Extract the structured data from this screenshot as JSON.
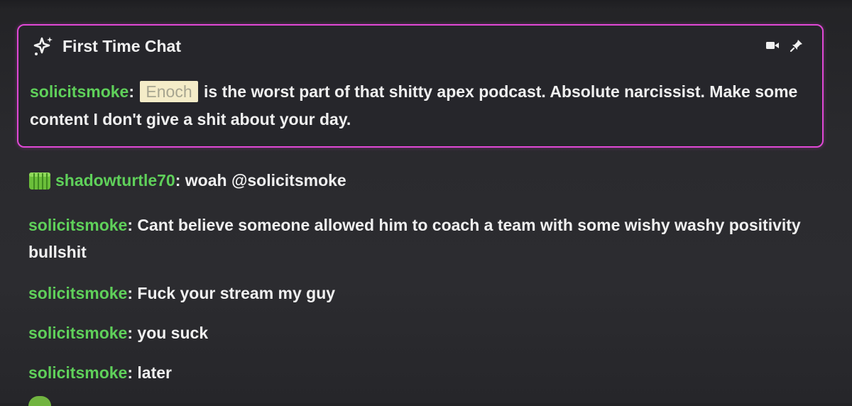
{
  "first_time_chat": {
    "title": "First Time Chat",
    "username": "solicitsmoke",
    "mention": "Enoch",
    "text_after_mention": " is the worst part of that shitty apex podcast. Absolute narcissist. Make some content I don't give a shit about your day.",
    "actions": [
      "video-camera-icon",
      "pin-icon"
    ]
  },
  "messages": [
    {
      "username": "shadowturtle70",
      "badge": "green-bits-badge",
      "text": " woah @solicitsmoke"
    },
    {
      "username": "solicitsmoke",
      "text": " Cant believe someone allowed him to coach a team with some wishy washy positivity bullshit"
    },
    {
      "username": "solicitsmoke",
      "text": " Fuck your stream my guy"
    },
    {
      "username": "solicitsmoke",
      "text": " you suck"
    },
    {
      "username": "solicitsmoke",
      "text": " later"
    }
  ],
  "colors": {
    "highlight_border": "#e048d6",
    "username_green": "#5fd05a",
    "mention_bg": "#f4ecc8",
    "background": "#2a2a2e"
  }
}
